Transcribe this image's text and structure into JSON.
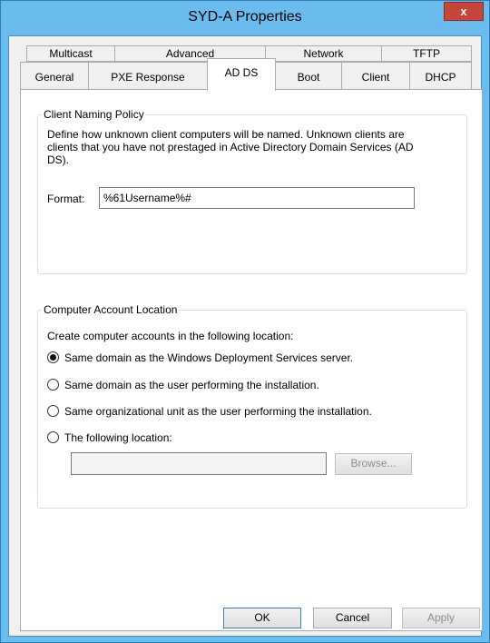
{
  "window": {
    "title": "SYD-A Properties",
    "close_glyph": "x"
  },
  "tabs": {
    "row1": [
      "Multicast",
      "Advanced",
      "Network",
      "TFTP"
    ],
    "row2": [
      "General",
      "PXE Response",
      "AD DS",
      "Boot",
      "Client",
      "DHCP"
    ],
    "active": "AD DS"
  },
  "naming_policy": {
    "group_title": "Client Naming Policy",
    "description": "Define how unknown client computers will be named. Unknown clients are clients that you have not prestaged in Active Directory Domain Services (AD DS).",
    "format_label": "Format:",
    "format_value": "%61Username%#"
  },
  "account_location": {
    "group_title": "Computer Account Location",
    "instruction": "Create computer accounts in the following location:",
    "options": [
      {
        "label": "Same domain as the Windows Deployment Services server.",
        "checked": true
      },
      {
        "label": "Same domain as the user performing the installation.",
        "checked": false
      },
      {
        "label": "Same organizational unit as the user performing the installation.",
        "checked": false
      },
      {
        "label": "The following location:",
        "checked": false
      }
    ],
    "location_value": "",
    "browse_label": "Browse..."
  },
  "buttons": {
    "ok": "OK",
    "cancel": "Cancel",
    "apply": "Apply"
  },
  "colors": {
    "title_bar": "#6bbcee",
    "close_button": "#c7463a"
  }
}
